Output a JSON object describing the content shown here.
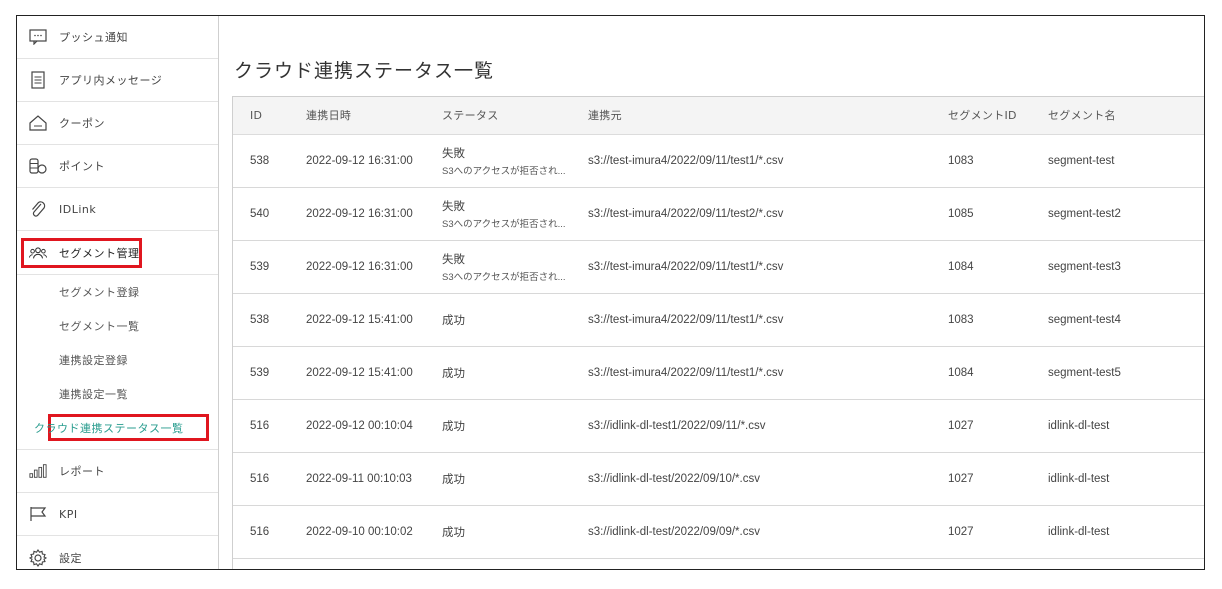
{
  "sidebar": {
    "items": [
      {
        "label": "プッシュ通知",
        "icon": "chat-bubble-icon"
      },
      {
        "label": "アプリ内メッセージ",
        "icon": "document-icon"
      },
      {
        "label": "クーポン",
        "icon": "tag-icon"
      },
      {
        "label": "ポイント",
        "icon": "coins-icon"
      },
      {
        "label": "IDLink",
        "icon": "paperclip-icon"
      },
      {
        "label": "セグメント管理",
        "icon": "users-icon"
      }
    ],
    "sub_items": [
      "セグメント登録",
      "セグメント一覧",
      "連携設定登録",
      "連携設定一覧",
      "クラウド連携ステータス一覧"
    ],
    "bottom_items": [
      {
        "label": "レポート",
        "icon": "bar-chart-icon"
      },
      {
        "label": "KPI",
        "icon": "flag-icon"
      },
      {
        "label": "設定",
        "icon": "gear-icon"
      }
    ]
  },
  "main": {
    "title": "クラウド連携ステータス一覧",
    "columns": [
      "ID",
      "連携日時",
      "ステータス",
      "連携元",
      "セグメントID",
      "セグメント名"
    ],
    "rows": [
      {
        "id": "538",
        "datetime": "2022-09-12 16:31:00",
        "status": "失敗",
        "error": "S3へのアクセスが拒否され...",
        "source": "s3://test-imura4/2022/09/11/test1/*.csv",
        "segment_id": "1083",
        "segment_name": "segment-test"
      },
      {
        "id": "540",
        "datetime": "2022-09-12 16:31:00",
        "status": "失敗",
        "error": "S3へのアクセスが拒否され...",
        "source": "s3://test-imura4/2022/09/11/test2/*.csv",
        "segment_id": "1085",
        "segment_name": "segment-test2"
      },
      {
        "id": "539",
        "datetime": "2022-09-12 16:31:00",
        "status": "失敗",
        "error": "S3へのアクセスが拒否され...",
        "source": "s3://test-imura4/2022/09/11/test1/*.csv",
        "segment_id": "1084",
        "segment_name": "segment-test3"
      },
      {
        "id": "538",
        "datetime": "2022-09-12 15:41:00",
        "status": "成功",
        "error": "",
        "source": "s3://test-imura4/2022/09/11/test1/*.csv",
        "segment_id": "1083",
        "segment_name": "segment-test4"
      },
      {
        "id": "539",
        "datetime": "2022-09-12 15:41:00",
        "status": "成功",
        "error": "",
        "source": "s3://test-imura4/2022/09/11/test1/*.csv",
        "segment_id": "1084",
        "segment_name": "segment-test5"
      },
      {
        "id": "516",
        "datetime": "2022-09-12 00:10:04",
        "status": "成功",
        "error": "",
        "source": "s3://idlink-dl-test1/2022/09/11/*.csv",
        "segment_id": "1027",
        "segment_name": "idlink-dl-test"
      },
      {
        "id": "516",
        "datetime": "2022-09-11 00:10:03",
        "status": "成功",
        "error": "",
        "source": "s3://idlink-dl-test/2022/09/10/*.csv",
        "segment_id": "1027",
        "segment_name": "idlink-dl-test"
      },
      {
        "id": "516",
        "datetime": "2022-09-10 00:10:02",
        "status": "成功",
        "error": "",
        "source": "s3://idlink-dl-test/2022/09/09/*.csv",
        "segment_id": "1027",
        "segment_name": "idlink-dl-test"
      }
    ]
  },
  "colors": {
    "highlight": "#e0161f",
    "active_link": "#2a9d8f"
  }
}
